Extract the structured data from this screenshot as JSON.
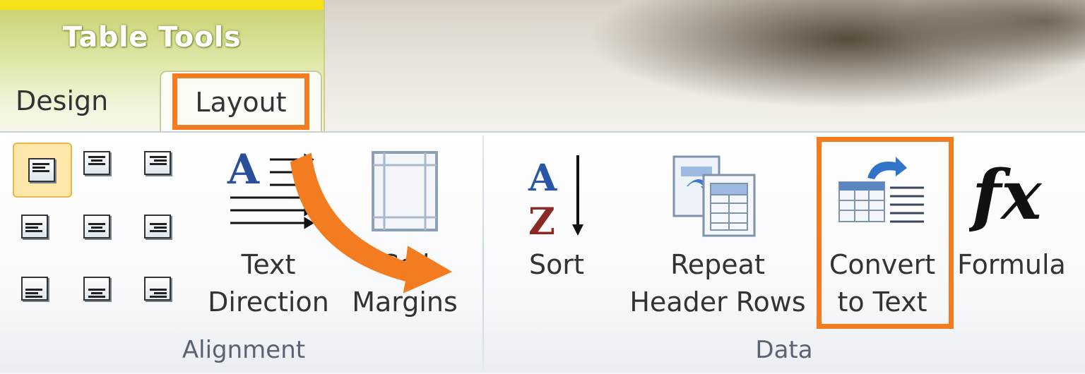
{
  "context_tab_group": {
    "title": "Table Tools"
  },
  "tabs": [
    {
      "label": "Design"
    },
    {
      "label": "Layout"
    }
  ],
  "groups": {
    "alignment": {
      "label": "Alignment",
      "text_direction": {
        "line1": "Text",
        "line2": "Direction"
      },
      "cell_margins": {
        "line1": "Cell",
        "line2": "Margins"
      }
    },
    "data": {
      "label": "Data",
      "sort": {
        "line1": "Sort"
      },
      "repeat_header_rows": {
        "line1": "Repeat",
        "line2": "Header Rows"
      },
      "convert_to_text": {
        "line1": "Convert",
        "line2": "to Text"
      },
      "formula": {
        "line1": "Formula"
      }
    }
  },
  "icons": {
    "sort": "sort-az-icon",
    "repeat_header_rows": "repeat-header-rows-icon",
    "convert_to_text": "convert-to-text-icon",
    "formula": "fx-formula-icon",
    "text_direction": "text-direction-icon",
    "cell_margins": "cell-margins-icon"
  },
  "colors": {
    "highlight": "#f47c20",
    "context_tab": "#c7cf6a",
    "context_stripe": "#f5e318",
    "active_align": "#fde7a8"
  }
}
